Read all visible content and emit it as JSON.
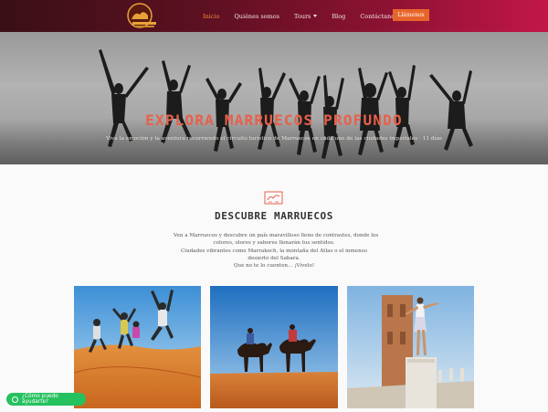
{
  "nav": {
    "items": [
      {
        "label": "Inicio",
        "active": true
      },
      {
        "label": "Quiénes somos",
        "active": false
      },
      {
        "label": "Tours",
        "active": false,
        "dropdown": true
      },
      {
        "label": "Blog",
        "active": false
      },
      {
        "label": "Contáctanos",
        "active": false
      }
    ],
    "cta": "Llámenos"
  },
  "hero": {
    "title": "EXPLORA MARRUECOS PROFUNDO",
    "subtitle": "Viva la emoción y la aventura recorriendo el circuito turístico de Marruecos en cada uno de las ciudades imperiales · 11 días"
  },
  "section": {
    "title": "DESCUBRE MARRUECOS",
    "text": [
      "Ven a Marruecos y descubre un país maravilloso lleno de contrastes, donde los",
      "colores, olores y sabores llenarán tus sentidos.",
      "Ciudades vibrantes como Marrakech, la montaña del Atlas o el inmenso",
      "desierto del Sahara.",
      "Que no te lo cuenten... ¡Vívelo!"
    ]
  },
  "whatsapp": {
    "label": "¿Cómo puedo ayudarte?"
  },
  "colors": {
    "accent": "#e8652a",
    "title": "#e8604a",
    "whatsapp": "#25c15e"
  }
}
